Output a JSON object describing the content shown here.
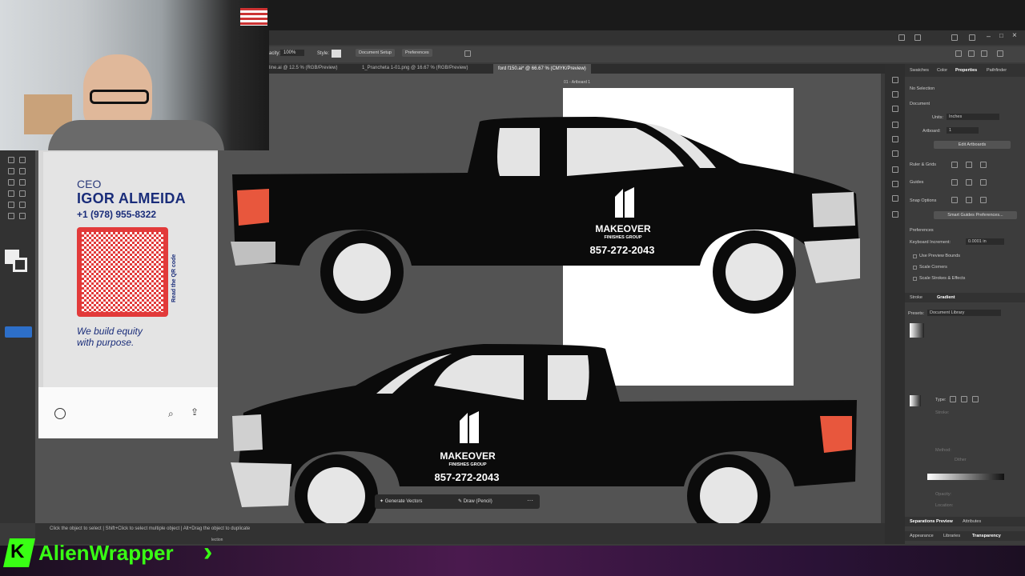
{
  "app": {
    "control_bar": {
      "opacity_label": "acity:",
      "opacity_value": "100%",
      "style_label": "Style:",
      "document_setup": "Document Setup",
      "preferences": "Preferences"
    },
    "tabs": [
      {
        "label": "line.ai @ 12.5 % (RGB/Preview)"
      },
      {
        "label": "1_Prancheta 1-01.png @ 16.67 % (RGB/Preview)"
      },
      {
        "label": "ford f150.ai* @ 66.67 % (CMYK/Preview)"
      }
    ],
    "artboard_label": "01 - Artboard 1",
    "panel_tabs": [
      "Swatches",
      "Color",
      "Properties",
      "Pathfinder"
    ],
    "properties": {
      "no_selection": "No Selection",
      "document": "Document",
      "units_label": "Units:",
      "units_value": "Inches",
      "artboard_label": "Artboard:",
      "artboard_value": "1",
      "edit_artboards": "Edit Artboards",
      "ruler_grids": "Ruler & Grids",
      "guides": "Guides",
      "snap_options": "Snap Options",
      "smart_guides_prefs": "Smart Guides Preferences...",
      "preferences": "Preferences",
      "keyboard_increment_label": "Keyboard Increment:",
      "keyboard_increment_value": "0.0001 in",
      "use_preview_bounds": "Use Preview Bounds",
      "scale_corners": "Scale Corners",
      "scale_strokes": "Scale Strokes & Effects"
    },
    "gradient_panel": {
      "tab_stroke": "Stroke",
      "tab_gradient": "Gradient",
      "presets_label": "Presets:",
      "presets_value": "Document Library",
      "type_label": "Type:",
      "stroke_label": "Stroke:",
      "method_label": "Method:",
      "dither": "Dither",
      "opacity_label": "Opacity:",
      "location_label": "Location:"
    },
    "bottom_panels": {
      "separations_preview": "Separations Preview",
      "attributes": "Attributes",
      "appearance": "Appearance",
      "libraries": "Libraries",
      "transparency": "Transparency"
    },
    "context_bar": {
      "generate_vectors": "Generate Vectors",
      "draw_pencil": "Draw (Pencil)"
    },
    "status": {
      "hint": "Click the object to select  |  Shift+Click to select multiple object  |  Alt+Drag the object to duplicate",
      "selection": "lection"
    }
  },
  "phone_card": {
    "title": "CEO",
    "name": "IGOR ALMEIDA",
    "phone": "+1 (978) 955-8322",
    "qr_caption": "Read the QR code",
    "slogan_line1": "We build equity",
    "slogan_line2": "with purpose."
  },
  "truck_graphics": {
    "company_name": "MAKEOVER",
    "company_sub": "FINISHES GROUP",
    "phone": "857-272-2043"
  },
  "overlay": {
    "brand": "AlienWrapper",
    "brand_mark": "K"
  },
  "colors": {
    "accent_green": "#39ff14",
    "truck_body": "#0b0b0b",
    "tail_light": "#e8573d",
    "card_text": "#1a2d7a",
    "qr_red": "#e23a3a"
  }
}
